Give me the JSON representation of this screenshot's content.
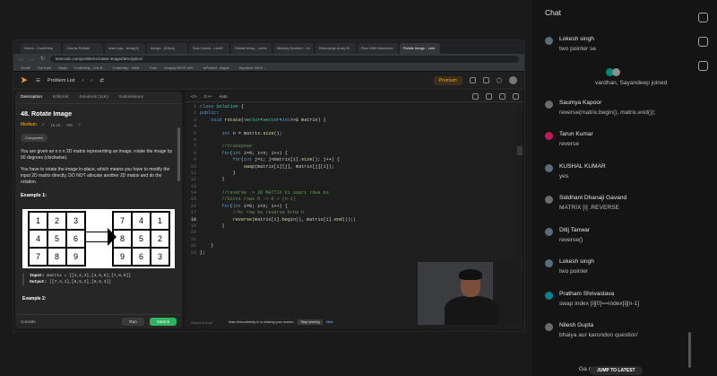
{
  "browser": {
    "tabs": [
      "Home - CodeHelp",
      "Course Builder",
      "main.cpp - Array(1)",
      "Arrays - [Extra]",
      "Sort Colors - LeetC",
      "Rotate Array - Leetc",
      "Missing Number - Le",
      "Rearrange Array El",
      "Row With Maximum",
      "Rotate Image - Leet"
    ],
    "url": "leetcode.com/problems/rotate-image/description/",
    "bookmarks": [
      "Gmail",
      "YouTube",
      "Maps",
      "CodeHelp - Dot B...",
      "CodeHelp - Web...",
      "Todo",
      "Graphy REST API...",
      "isPicked - Algori...",
      "Supreme 2023 -..."
    ]
  },
  "leetcode": {
    "problem_list": "Problem List",
    "premium": "Premium",
    "tabs": [
      "Description",
      "Editorial",
      "Solutions (11K)",
      "Submissions"
    ],
    "title": "48. Rotate Image",
    "difficulty": "Medium",
    "likes": "16.1K",
    "dislikes": "705",
    "companies": "Companies",
    "p1": "You are given an n x n 2D matrix representing an image, rotate the image by 90 degrees (clockwise).",
    "p2": "You have to rotate the image in-place, which means you have to modify the input 2D matrix directly. DO NOT allocate another 2D matrix and do the rotation.",
    "example1": "Example 1:",
    "matrix_before": [
      [
        "1",
        "2",
        "3"
      ],
      [
        "4",
        "5",
        "6"
      ],
      [
        "7",
        "8",
        "9"
      ]
    ],
    "matrix_after": [
      [
        "7",
        "4",
        "1"
      ],
      [
        "8",
        "5",
        "2"
      ],
      [
        "9",
        "6",
        "3"
      ]
    ],
    "input_label": "Input:",
    "input_val": "matrix = [[1,2,3],[4,5,6],[7,8,9]]",
    "output_label": "Output:",
    "output_val": "[[7,4,1],[8,5,2],[9,6,3]]",
    "example2": "Example 2:",
    "console": "Console",
    "run": "Run",
    "submit": "Submit",
    "lang": "C++",
    "auto": "Auto",
    "saved": "Saved to local",
    "share_text": "learn.thecodehelp.in is sharing your screen.",
    "stop_sharing": "Stop sharing",
    "hide": "Hide"
  },
  "code_lines": [
    {
      "n": "1",
      "html": "<span class='kw'>class</span> <span class='ty'>Solution</span> <span class='pl'>{</span>"
    },
    {
      "n": "2",
      "html": "<span class='kw'>public</span><span class='pl'>:</span>"
    },
    {
      "n": "3",
      "html": "    <span class='kw'>void</span> <span class='fn'>rotate</span><span class='pl'>(</span><span class='ty'>vector</span><span class='pl'>&lt;</span><span class='ty'>vector</span><span class='pl'>&lt;</span><span class='kw'>int</span><span class='pl'>&gt;&gt;&amp; matrix) {</span>"
    },
    {
      "n": "4",
      "html": ""
    },
    {
      "n": "5",
      "html": "        <span class='kw'>int</span> <span class='pl'>n = matrix.</span><span class='fn'>size</span><span class='pl'>();</span>"
    },
    {
      "n": "6",
      "html": ""
    },
    {
      "n": "7",
      "html": "        <span class='cm'>//transpose</span>"
    },
    {
      "n": "8",
      "html": "        <span class='kw'>for</span><span class='pl'>(</span><span class='kw'>int</span> <span class='pl'>i=0; i&lt;n; i++) {</span>"
    },
    {
      "n": "9",
      "html": "            <span class='kw'>for</span><span class='pl'>(</span><span class='kw'>int</span> <span class='pl'>j=i; j&lt;matrix[i].</span><span class='fn'>size</span><span class='pl'>(); j++) {</span>"
    },
    {
      "n": "10",
      "html": "                <span class='fn'>swap</span><span class='pl'>(matrix[i][j], matrix[j][i]);</span>"
    },
    {
      "n": "11",
      "html": "            <span class='pl'>}</span>"
    },
    {
      "n": "12",
      "html": "        <span class='pl'>}</span>"
    },
    {
      "n": "13",
      "html": ""
    },
    {
      "n": "14",
      "html": "        <span class='cm'>//reverse -&gt; 2D MATTIX ki saari rows ko</span>"
    },
    {
      "n": "15",
      "html": "        <span class='cm'>//kitni rows h -&gt; 0 &gt; (n-1)</span>"
    },
    {
      "n": "16",
      "html": "        <span class='kw'>for</span><span class='pl'>(</span><span class='kw'>int</span> <span class='pl'>i=0; i&lt;n; i++) {</span>"
    },
    {
      "n": "17",
      "html": "            <span class='cm'>//hr row ko reverse krna h</span>"
    },
    {
      "n": "18",
      "html": "            <span class='fn'>reverse</span><span class='pl'>(matrix[i].</span><span class='fn'>begin</span><span class='pl'>(), matrix[i].</span><span class='fn'>end</span><span class='pl'>());|</span>"
    },
    {
      "n": "19",
      "html": "        <span class='pl'>}</span>"
    },
    {
      "n": "20",
      "html": ""
    },
    {
      "n": "21",
      "html": ""
    },
    {
      "n": "22",
      "html": "    <span class='pl'>}</span>"
    },
    {
      "n": "23",
      "html": "<span class='pl'>};</span>"
    }
  ],
  "chat": {
    "title": "Chat",
    "jump": "JUMP TO LATEST",
    "messages": [
      {
        "type": "msg",
        "name": "Lokesh singh",
        "text": "two pointer se",
        "color": "#5a6b7a"
      },
      {
        "type": "join",
        "text": "vardhan, Sayandeep joined"
      },
      {
        "type": "msg",
        "name": "Saumya Kapoor",
        "text": "reverse(matrix.begin(), matrix.end());",
        "color": "#6b6b6b"
      },
      {
        "type": "msg",
        "name": "Tarun Kumar",
        "text": "reverse",
        "color": "#c2185b"
      },
      {
        "type": "msg",
        "name": "KUSHAL KUMAR",
        "text": "yes",
        "color": "#5a6b7a"
      },
      {
        "type": "msg",
        "name": "Siddhant Dhanaji Gavand",
        "text": "MATRIX [I] .REVERSE",
        "color": "#6b6b6b"
      },
      {
        "type": "msg",
        "name": "Ditij Tanwar",
        "text": "reverse()",
        "color": "#5a6b7a"
      },
      {
        "type": "msg",
        "name": "Lokesh singh",
        "text": "two pointer",
        "color": "#5a6b7a"
      },
      {
        "type": "msg",
        "name": "Pratham Shrivastava",
        "text": "swap index [i][0]==index[i][n-1]",
        "color": "#00838f"
      },
      {
        "type": "msg",
        "name": "Nilesh Gupta",
        "text": "bhaiya aur karondon question'",
        "color": "#6b6b6b"
      }
    ],
    "last_partial": "Ga                       ned"
  }
}
